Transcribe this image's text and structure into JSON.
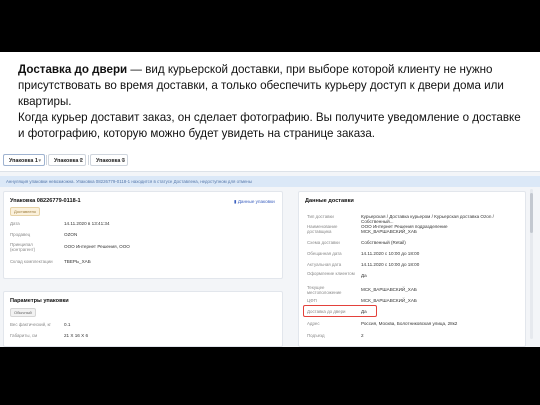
{
  "intro": {
    "bold": "Доставка до двери",
    "rest": " — вид курьерской доставки, при выборе которой клиенту не нужно присутствовать во время доставки, а только обеспечить курьеру доступ к двери дома или квартиры.",
    "line2": "Когда курьер доставит заказ, он сделает фотографию. Вы получите уведомление о доставке и фотографию, которую можно будет увидеть на странице заказа."
  },
  "tabs": [
    {
      "label": "Упаковка 1"
    },
    {
      "label": "Упаковка 2"
    },
    {
      "label": "Упаковка 3"
    }
  ],
  "alert": "Аннуляция упаковки невозможна. Упаковка 08226779-0118-1 находится в статусе Доставлена, недоступном для отмены",
  "package": {
    "title": "Упаковка 08226779-0118-1",
    "badge": "Доставлено",
    "button": "Данные упаковки",
    "rows": [
      {
        "label": "Дата",
        "value": "14.11.2020 в 13:41:34"
      },
      {
        "label": "Продавец",
        "value": "OZON"
      },
      {
        "label": "Принципал (контрагент)",
        "value": "ООО Интернет Решения, ООО"
      },
      {
        "label": "Склад комплектации",
        "value": "ТВЕРЬ_ХАБ"
      }
    ]
  },
  "params": {
    "title": "Параметры упаковки",
    "badge": "Обычный",
    "rows": [
      {
        "label": "Вес фактический, кг",
        "value": "0.1"
      },
      {
        "label": "Габариты, см",
        "value": "21 X 16 X 6"
      }
    ]
  },
  "delivery": {
    "title": "Данные доставки",
    "rows": [
      {
        "label": "Тип доставки",
        "value": "Курьерская / Доставка курьером / Курьерская доставка Ozon / Собственный..."
      },
      {
        "label": "Наименование доставщика",
        "value": "ООО Интернет Решения подразделение МСК_ВАРШАВСКИЙ_ХАБ"
      },
      {
        "label": "Схема доставки",
        "value": "Собственный (Retail)"
      },
      {
        "label": "Обещанная дата",
        "value": "14.11.2020 с 10:00 до 18:00"
      },
      {
        "label": "Актуальная дата",
        "value": "14.11.2020 с 10:00 до 18:00"
      },
      {
        "label": "Оформление клиентом",
        "value": "Да"
      },
      {
        "label": "Текущее местоположение",
        "value": "МСК_ВАРШАВСКИЙ_ХАБ"
      },
      {
        "label": "ЦФП",
        "value": "МСК_ВАРШАВСКИЙ_ХАБ"
      },
      {
        "label": "Доставка до двери",
        "value": "Да"
      },
      {
        "label": "Адрес",
        "value": "Россия, Москва, Болотниковская улица, 28к2"
      },
      {
        "label": "Подъезд",
        "value": "2"
      }
    ]
  },
  "colors": {
    "highlight": "#e3413b",
    "alert_bg": "#dbe8f7",
    "link": "#3a5fbf"
  }
}
